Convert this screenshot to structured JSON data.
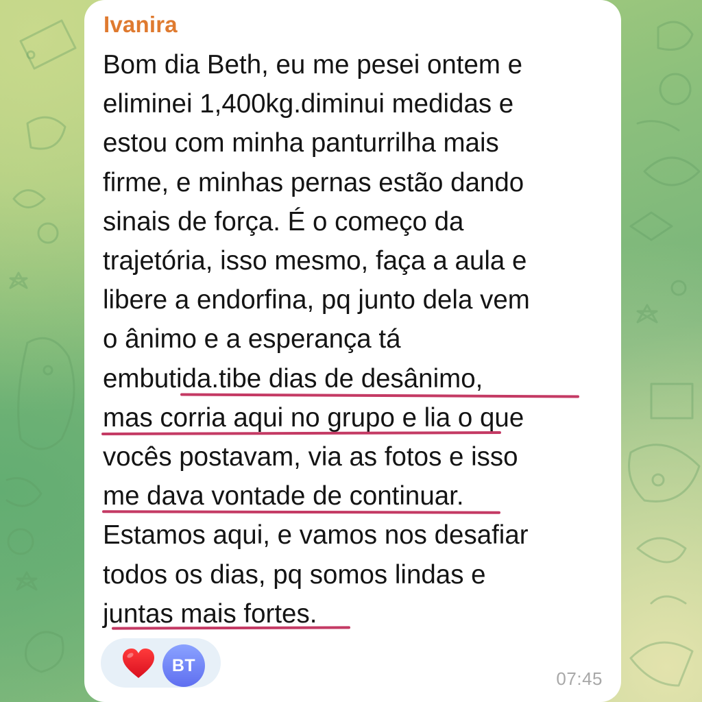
{
  "message": {
    "sender": "Ivanira",
    "lines": [
      "Bom dia Beth, eu me pesei ontem e",
      "eliminei 1,400kg.diminui medidas e",
      "estou com minha panturrilha mais",
      "firme, e minhas pernas estão dando",
      "sinais de força. É o começo da",
      "trajetória,  isso mesmo, faça a aula e",
      "libere a endorfina,  pq junto dela vem",
      "o ânimo e a esperança tá",
      "embutida.tibe dias de desânimo,",
      "mas corria aqui no grupo e lia o que",
      "vocês postavam, via as fotos e isso",
      "me dava vontade de continuar.",
      "Estamos aqui, e vamos nos desafiar",
      "todos os dias,  pq somos lindas e",
      "juntas mais fortes."
    ],
    "time": "07:45",
    "reactions": {
      "emoji": "heart-icon",
      "avatar_initials": "BT",
      "avatar_color": "#6b7ff5"
    },
    "underline_color": "#c43a64"
  },
  "colors": {
    "sender_name": "#df7a2f",
    "bubble_bg": "#ffffff",
    "reaction_bg": "#e7f0f8"
  }
}
